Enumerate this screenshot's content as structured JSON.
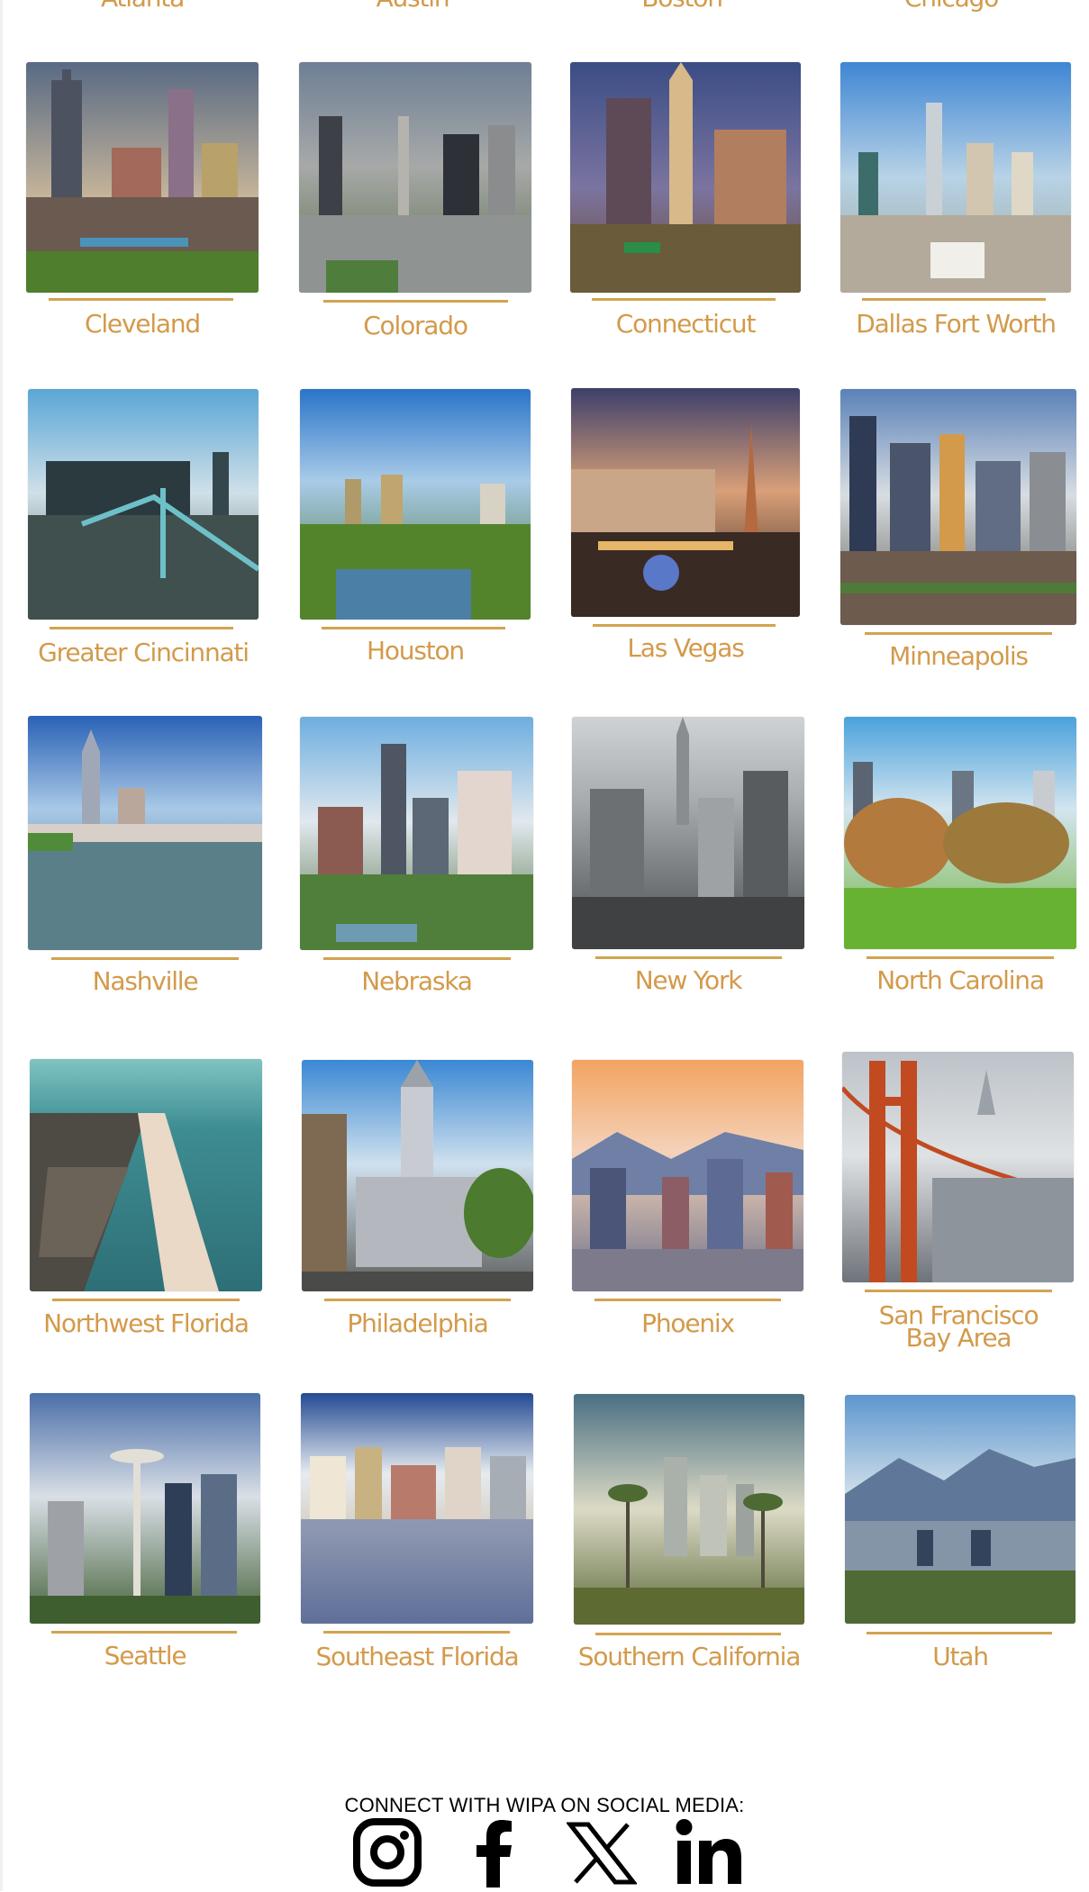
{
  "top_row_labels": [
    "Atlanta",
    "Austin",
    "Boston",
    "Chicago"
  ],
  "chapters": [
    {
      "label": "Cleveland",
      "image": "Cleveland skyline photo"
    },
    {
      "label": "Colorado",
      "image": "Denver skyline photo"
    },
    {
      "label": "Connecticut",
      "image": "Hartford skyline photo"
    },
    {
      "label": "Dallas Fort Worth",
      "image": "Dallas skyline photo"
    },
    {
      "label": "Greater Cincinnati",
      "image": "Cincinnati bridge skyline photo"
    },
    {
      "label": "Houston",
      "image": "Houston park skyline photo"
    },
    {
      "label": "Las Vegas",
      "image": "Las Vegas strip photo"
    },
    {
      "label": "Minneapolis",
      "image": "Minneapolis skyline photo"
    },
    {
      "label": "Nashville",
      "image": "Nashville river skyline photo"
    },
    {
      "label": "Nebraska",
      "image": "Omaha skyline photo"
    },
    {
      "label": "New York",
      "image": "New York City aerial photo"
    },
    {
      "label": "North Carolina",
      "image": "Raleigh park skyline photo"
    },
    {
      "label": "Northwest Florida",
      "image": "Northwest Florida coastline photo"
    },
    {
      "label": "Philadelphia",
      "image": "Philadelphia city hall photo"
    },
    {
      "label": "Phoenix",
      "image": "Phoenix skyline photo"
    },
    {
      "label": "San Francisco\nBay Area",
      "image": "Golden Gate bridge photo"
    },
    {
      "label": "Seattle",
      "image": "Seattle space needle photo"
    },
    {
      "label": "Southeast Florida",
      "image": "Miami waterfront photo"
    },
    {
      "label": "Southern California",
      "image": "Los Angeles palms skyline photo"
    },
    {
      "label": "Utah",
      "image": "Salt Lake City mountains photo"
    }
  ],
  "social": {
    "heading": "CONNECT WITH WIPA ON SOCIAL MEDIA:",
    "icons": [
      "instagram-icon",
      "facebook-icon",
      "x-icon",
      "linkedin-icon"
    ]
  },
  "colors": {
    "label": "#d39a4b",
    "rule": "#d2a351",
    "text": "#000000",
    "background": "#ffffff"
  }
}
